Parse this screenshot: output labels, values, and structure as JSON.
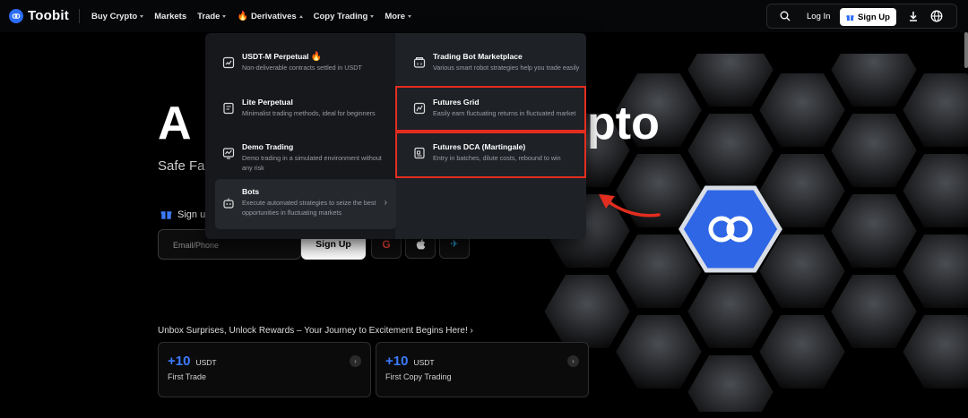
{
  "brand": {
    "name": "Toobit"
  },
  "nav": {
    "items": [
      {
        "label": "Buy Crypto",
        "caret": true
      },
      {
        "label": "Markets",
        "caret": false
      },
      {
        "label": "Trade",
        "caret": true
      },
      {
        "label": "Derivatives",
        "caret": true,
        "fire": true
      },
      {
        "label": "Copy Trading",
        "caret": true
      },
      {
        "label": "More",
        "caret": true
      }
    ],
    "login": "Log In",
    "signup": "Sign Up"
  },
  "hero": {
    "headline_left": "A",
    "headline_right": "pto",
    "subline": "Safe  Fa",
    "gift_text": "Sign up",
    "email_placeholder": "Email/Phone",
    "signup_button": "Sign Up",
    "social": [
      "G",
      "",
      "✈"
    ]
  },
  "promo": {
    "title": "Unbox Surprises, Unlock Rewards – Your Journey to Excitement Begins Here!",
    "cards": [
      {
        "value": "+10",
        "unit": "USDT",
        "label": "First Trade"
      },
      {
        "value": "+10",
        "unit": "USDT",
        "label": "First Copy Trading"
      }
    ]
  },
  "dropdown": {
    "left": [
      {
        "title": "USDT-M Perpetual",
        "fire": true,
        "desc": "Non-deliverable contracts settled in USDT"
      },
      {
        "title": "Lite Perpetual",
        "desc": "Minimalist trading methods, ideal for beginners"
      },
      {
        "title": "Demo Trading",
        "desc": "Demo trading in a simulated environment without any risk"
      },
      {
        "title": "Bots",
        "desc": "Execute automated strategies to seize the best opportunities in fluctuating markets"
      }
    ],
    "right": [
      {
        "title": "Trading Bot Marketplace",
        "desc": "Various smart robot strategies help you trade easily"
      },
      {
        "title": "Futures Grid",
        "desc": "Easily earn fluctuating returns in fluctuated market"
      },
      {
        "title": "Futures DCA (Martingale)",
        "desc": "Entry in batches, dilute costs, rebound to win"
      }
    ]
  },
  "colors": {
    "accent": "#2c6cf6",
    "highlight": "#e32d1f",
    "fire": "#ff4b2b"
  }
}
